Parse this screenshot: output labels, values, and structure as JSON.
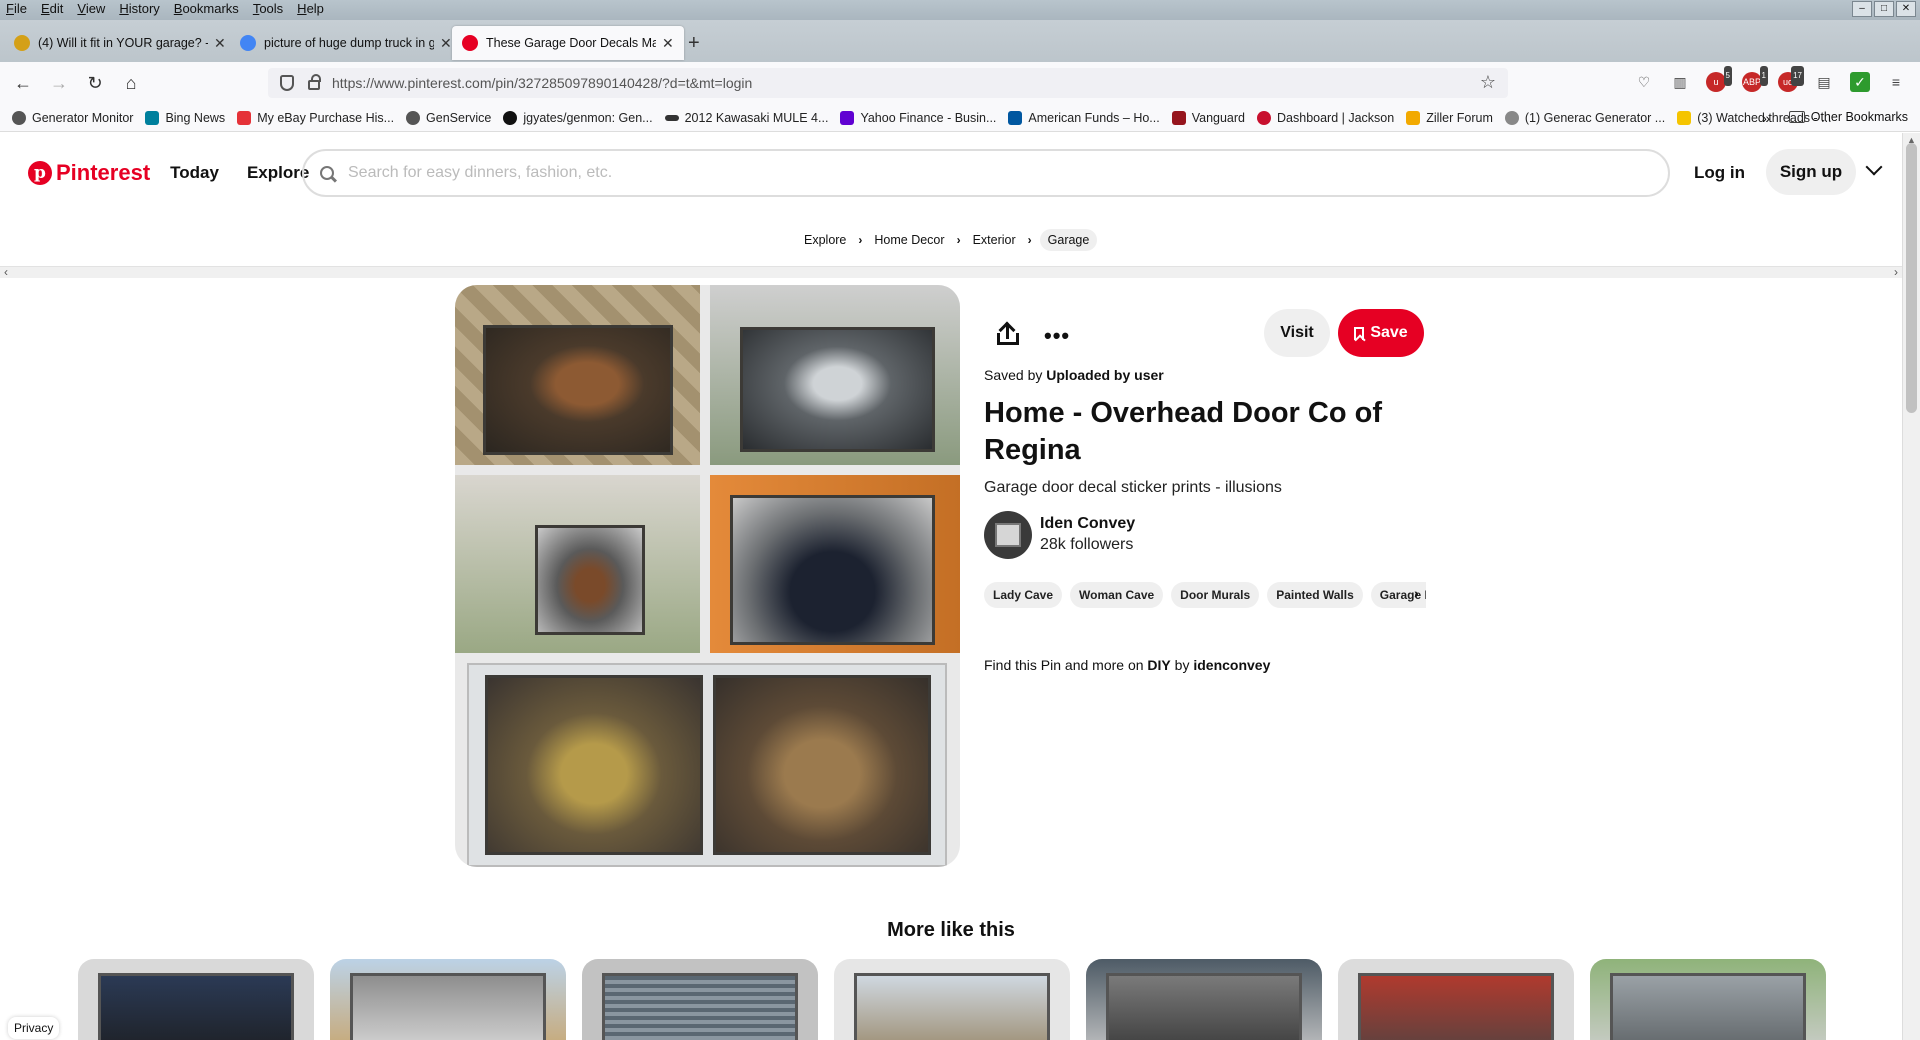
{
  "menubar": {
    "items": [
      "File",
      "Edit",
      "View",
      "History",
      "Bookmarks",
      "Tools",
      "Help"
    ]
  },
  "tabs": [
    {
      "title": "(4) Will it fit in YOUR garage? -",
      "favicon_color": "#d4a017"
    },
    {
      "title": "picture of huge dump truck in g",
      "favicon_color": "#4285f4"
    },
    {
      "title": "These Garage Door Decals Make",
      "favicon_color": "#e60023",
      "active": true
    }
  ],
  "navbar": {
    "url": "https://www.pinterest.com/pin/327285097890140428/?d=t&mt=login",
    "ext_badges": [
      "5",
      "1",
      "17"
    ]
  },
  "bookmarks": {
    "items": [
      {
        "label": "Generator Monitor",
        "color": "#555555"
      },
      {
        "label": "Bing News",
        "color": "#00809d"
      },
      {
        "label": "My eBay Purchase His...",
        "color": "#e53238"
      },
      {
        "label": "GenService",
        "color": "#555555"
      },
      {
        "label": "jgyates/genmon: Gen...",
        "color": "#111111"
      },
      {
        "label": "2012 Kawasaki MULE 4...",
        "color": "#333333"
      },
      {
        "label": "Yahoo Finance - Busin...",
        "color": "#6001d2"
      },
      {
        "label": "American Funds – Ho...",
        "color": "#0057a0"
      },
      {
        "label": "Vanguard",
        "color": "#96151d"
      },
      {
        "label": "Dashboard | Jackson",
        "color": "#c8102e"
      },
      {
        "label": "Ziller Forum",
        "color": "#f2a900"
      },
      {
        "label": "(1) Generac Generator ...",
        "color": "#888888"
      },
      {
        "label": "(3) Watched threads - ...",
        "color": "#f5c400"
      }
    ],
    "overflow": "»",
    "other": "Other Bookmarks"
  },
  "header": {
    "logo": "Pinterest",
    "nav_today": "Today",
    "nav_explore": "Explore",
    "search_placeholder": "Search for easy dinners, fashion, etc.",
    "login": "Log in",
    "signup": "Sign up"
  },
  "breadcrumb": [
    "Explore",
    "Home Decor",
    "Exterior",
    "Garage"
  ],
  "pin": {
    "saved_by_prefix": "Saved by",
    "saved_by": "Uploaded by user",
    "title": "Home - Overhead Door Co of Regina",
    "description": "Garage door decal sticker prints - illusions",
    "creator_name": "Iden Convey",
    "creator_followers": "28k followers",
    "tags": [
      "Lady Cave",
      "Woman Cave",
      "Door Murals",
      "Painted Walls",
      "Garage Ideas"
    ],
    "find_prefix": "Find this Pin and more on",
    "board": "DIY",
    "by": "by",
    "board_owner": "idenconvey",
    "visit_label": "Visit",
    "save_label": "Save"
  },
  "more_like_this": {
    "title": "More like this"
  },
  "privacy": "Privacy",
  "colors": {
    "brand": "#e60023",
    "chip_bg": "#efefef"
  }
}
